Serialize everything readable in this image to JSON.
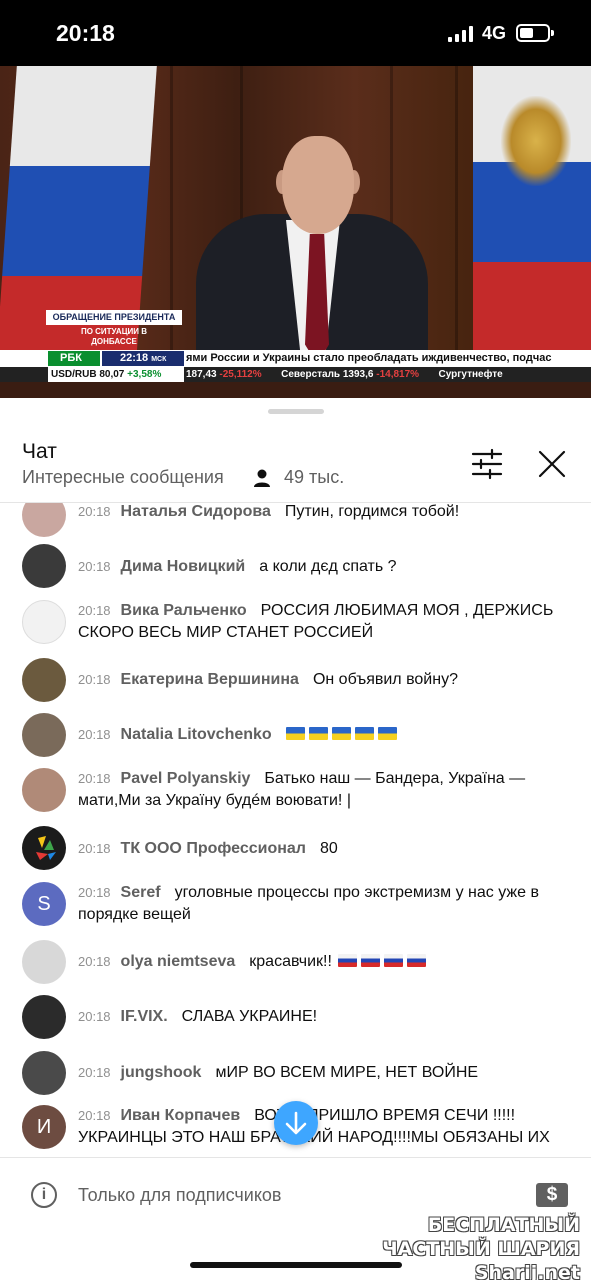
{
  "status_bar": {
    "time": "20:18",
    "network": "4G"
  },
  "video": {
    "overlay_title": "ОБРАЩЕНИЕ ПРЕЗИДЕНТА",
    "overlay_subtitle": "ПО СИТУАЦИИ В ДОНБАССЕ",
    "channel_logo": "РБК",
    "ticker_time": "22:18",
    "ticker_time_zone": "МСК",
    "ticker_headline": "ями России и Украины стало преобладать иждивенчество, подчас",
    "usd_rate": "USD/RUB 80,07",
    "usd_change": "+3,58%",
    "stocks_1_value": "187,43",
    "stocks_1_change": "-25,112%",
    "stocks_2_name": "Северсталь 1393,6",
    "stocks_2_change": "-14,817%",
    "stocks_3_name": "Сургутнефте"
  },
  "chat": {
    "title": "Чат",
    "mode": "Интересные сообщения",
    "viewers": "49 тыс."
  },
  "messages": [
    {
      "time": "20:18",
      "author": "Наталья Сидорова",
      "text": "Путин, гордимся тобой!",
      "avatar": "photo",
      "color": "#c9a7a0"
    },
    {
      "time": "20:18",
      "author": "Дима Новицкий",
      "text": "а коли дєд спать ?",
      "avatar": "photo",
      "color": "#3a3a3a"
    },
    {
      "time": "20:18",
      "author": "Вика Ральченко",
      "text": "РОССИЯ ЛЮБИМАЯ МОЯ , ДЕРЖИСЬ СКОРО ВЕСЬ МИР СТАНЕТ РОССИЕЙ",
      "avatar": "photo",
      "color": "#f2f2f2"
    },
    {
      "time": "20:18",
      "author": "Екатерина Вершинина",
      "text": "Он объявил войну?",
      "avatar": "photo",
      "color": "#6b5a3e"
    },
    {
      "time": "20:18",
      "author": "Natalia Litovchenko",
      "text": "",
      "flags": "ua",
      "flag_count": 5,
      "avatar": "photo",
      "color": "#7a6a5a"
    },
    {
      "time": "20:18",
      "author": "Pavel Polyanskiy",
      "text": "Батько наш — Бандера, Україна — мати,Ми за Україну будéм воювати! |",
      "avatar": "photo",
      "color": "#b08a78"
    },
    {
      "time": "20:18",
      "author": "ТК ООО Профессионал",
      "text": "80",
      "avatar": "logo",
      "color": "#1b1b1b"
    },
    {
      "time": "20:18",
      "author": "Seref",
      "text": "уголовные процессы про экстремизм у нас уже в порядке вещей",
      "avatar": "letter",
      "letter": "S",
      "color": "#5c6bc0"
    },
    {
      "time": "20:18",
      "author": "olya niemtseva",
      "text": "красавчик!!",
      "flags": "ru",
      "flag_count": 4,
      "avatar": "photo",
      "color": "#d8d8d8"
    },
    {
      "time": "20:18",
      "author": "IF.VIX.",
      "text": "СЛАВА УКРАИНЕ!",
      "avatar": "photo",
      "color": "#2b2b2b"
    },
    {
      "time": "20:18",
      "author": "jungshook",
      "text": "мИР ВО ВСЕМ МИРЕ, НЕТ ВОЙНЕ",
      "avatar": "photo",
      "color": "#4a4a4a"
    },
    {
      "time": "20:18",
      "author": "Иван Корпачев",
      "text": "ВОТ И ПРИШЛО ВРЕМЯ СЕЧИ !!!!! УКРАИНЦЫ ЭТО НАШ БРАТСКИЙ НАРОД!!!!МЫ ОБЯЗАНЫ ИХ",
      "avatar": "letter",
      "letter": "И",
      "color": "#6d4c41"
    }
  ],
  "composer": {
    "placeholder": "Только для подписчиков",
    "dollar_label": "$"
  },
  "watermark": "БЕСПЛАТНЫЙ ЧАСТНЫЙ ШАРИЯ Sharij.net",
  "colors": {
    "accent": "#3ea6ff",
    "text_secondary": "#606060"
  }
}
